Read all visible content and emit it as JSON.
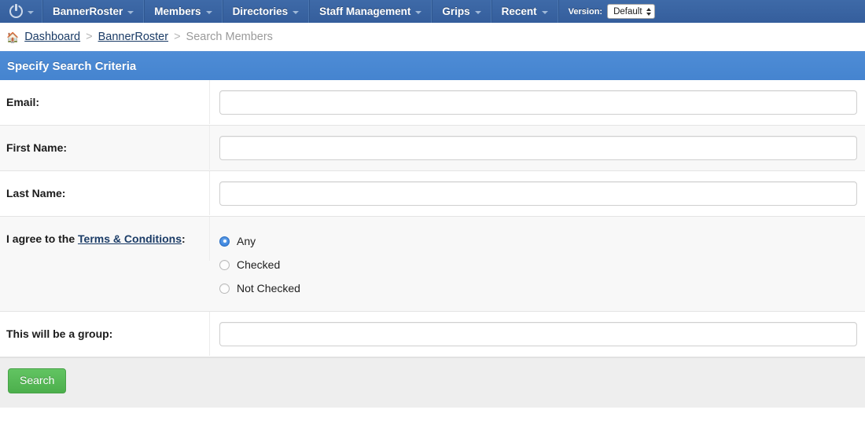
{
  "navbar": {
    "brand_icon": "power-icon",
    "items": [
      {
        "label": "BannerRoster",
        "caret": true
      },
      {
        "label": "Members",
        "caret": true
      },
      {
        "label": "Directories",
        "caret": true
      },
      {
        "label": "Staff Management",
        "caret": true
      },
      {
        "label": "Grips",
        "caret": true
      },
      {
        "label": "Recent",
        "caret": true
      }
    ],
    "version": {
      "label": "Version:",
      "selected": "Default",
      "options": [
        "Default"
      ]
    },
    "bg_color": "#3a65a3"
  },
  "breadcrumb": {
    "home_icon": "home-icon",
    "items": [
      {
        "label": "Dashboard",
        "link": true
      },
      {
        "label": "BannerRoster",
        "link": true
      },
      {
        "label": "Search Members",
        "link": false
      }
    ],
    "separator": ">",
    "link_color": "#1a3b66",
    "current_color": "#9a9a9a"
  },
  "panel": {
    "heading": "Specify Search Criteria",
    "heading_bg": "#4a89d4",
    "rows": [
      {
        "label": "Email:",
        "type": "text",
        "value": "",
        "placeholder": ""
      },
      {
        "label": "First Name:",
        "type": "text",
        "value": "",
        "placeholder": ""
      },
      {
        "label": "Last Name:",
        "type": "text",
        "value": "",
        "placeholder": ""
      },
      {
        "label_prefix": "I agree to the ",
        "label_link": "Terms & Conditions",
        "label_suffix": ":",
        "type": "radio",
        "options": [
          {
            "label": "Any",
            "selected": true
          },
          {
            "label": "Checked",
            "selected": false
          },
          {
            "label": "Not Checked",
            "selected": false
          }
        ]
      },
      {
        "label": "This will be a group:",
        "type": "text",
        "value": "",
        "placeholder": ""
      }
    ],
    "footer": {
      "search_label": "Search",
      "button_color": "#5cb85c",
      "bg_color": "#eeeeee"
    }
  }
}
